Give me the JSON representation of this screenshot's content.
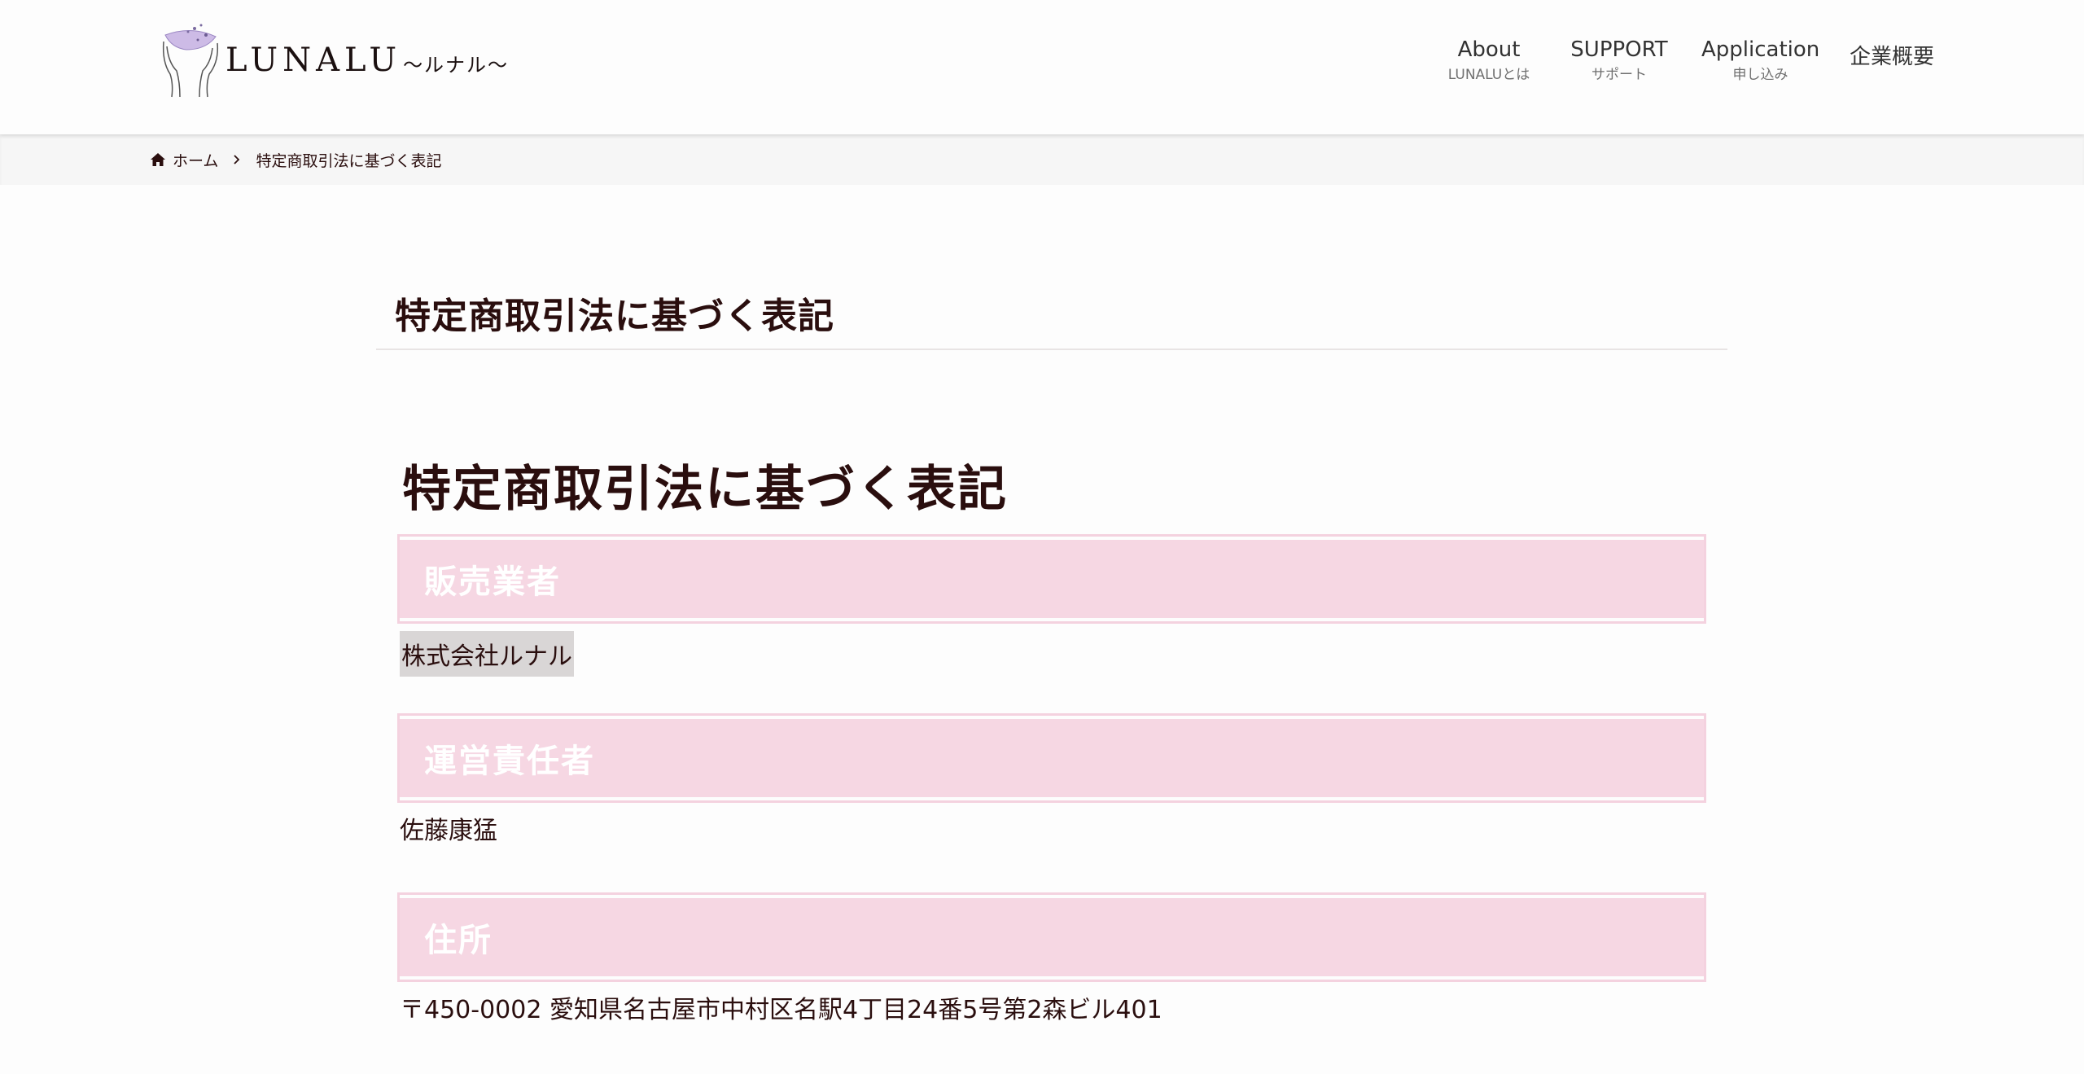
{
  "header": {
    "logo_text": "LUNALU",
    "logo_sub": "〜ルナル〜",
    "nav": [
      {
        "main": "About",
        "sub": "LUNALUとは"
      },
      {
        "main": "SUPPORT",
        "sub": "サポート"
      },
      {
        "main": "Application",
        "sub": "申し込み"
      },
      {
        "main": "企業概要",
        "sub": ""
      }
    ]
  },
  "breadcrumb": {
    "home": "ホーム",
    "current": "特定商取引法に基づく表記"
  },
  "page": {
    "title": "特定商取引法に基づく表記",
    "content_heading": "特定商取引法に基づく表記",
    "sections": [
      {
        "heading": "販売業者",
        "body": "株式会社ルナル"
      },
      {
        "heading": "運営責任者",
        "body": "佐藤康猛"
      },
      {
        "heading": "住所",
        "body": "〒450-0002 愛知県名古屋市中村区名駅4丁目24番5号第2森ビル401"
      }
    ]
  },
  "colors": {
    "section_bg": "#f6d7e3",
    "text": "#2a0e0e",
    "accent_logo": "#b9a4d8"
  }
}
